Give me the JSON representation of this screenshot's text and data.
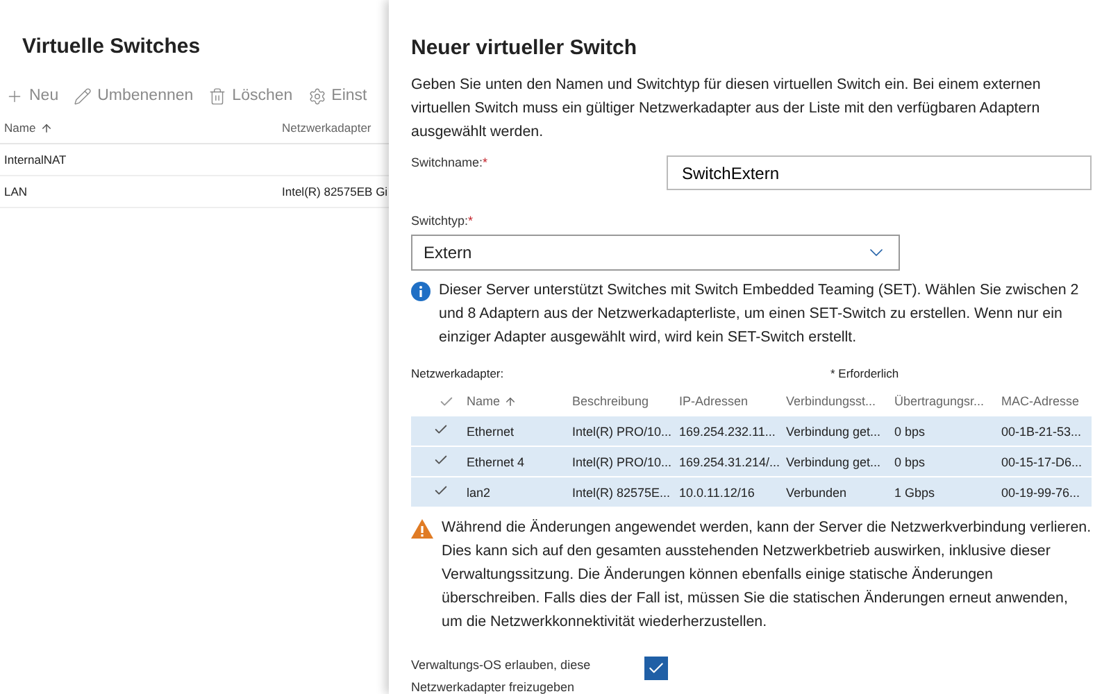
{
  "list_panel": {
    "title": "Virtuelle Switches",
    "toolbar": [
      {
        "label": "Neu"
      },
      {
        "label": "Umbenennen"
      },
      {
        "label": "Löschen"
      },
      {
        "label": "Einst"
      }
    ],
    "columns": [
      {
        "label": "Name",
        "sorted": true
      },
      {
        "label": "Netzwerkadapter",
        "sorted": false
      }
    ],
    "rows": [
      [
        "InternalNAT",
        ""
      ],
      [
        "LAN",
        "Intel(R) 82575EB Gi"
      ]
    ]
  },
  "dialog": {
    "title": "Neuer virtueller Switch",
    "intro": "Geben Sie unten den Namen und Switchtyp für diesen virtuellen Switch ein. Bei einem externen virtuellen Switch muss ein gültiger Netzwerkadapter aus der Liste mit den verfügbaren Adaptern ausgewählt werden.",
    "name_field": {
      "label": "Switchname:",
      "required_mark": "*",
      "value": "SwitchExtern"
    },
    "type_field": {
      "label": "Switchtyp:",
      "required_mark": "*",
      "value": "Extern"
    },
    "info": "Dieser Server unterstützt Switches mit Switch Embedded Teaming (SET). Wählen Sie zwischen 2 und 8 Adaptern aus der Netzwerkadapterliste, um einen SET-Switch zu erstellen. Wenn nur ein einziger Adapter ausgewählt wird, wird kein SET-Switch erstellt.",
    "adapters": {
      "label": "Netzwerkadapter:",
      "required_note": "* Erforderlich",
      "columns": [
        {
          "label": "Name",
          "sorted": true
        },
        {
          "label": "Beschreibung",
          "sorted": false
        },
        {
          "label": "IP-Adressen",
          "sorted": false
        },
        {
          "label": "Verbindungsst...",
          "sorted": false
        },
        {
          "label": "Übertragungsr...",
          "sorted": false
        },
        {
          "label": "MAC-Adresse",
          "sorted": false
        }
      ],
      "rows": [
        {
          "selected": true,
          "cells": [
            "Ethernet",
            "Intel(R) PRO/10...",
            "169.254.232.11...",
            "Verbindung get...",
            "0 bps",
            "00-1B-21-53..."
          ]
        },
        {
          "selected": true,
          "cells": [
            "Ethernet 4",
            "Intel(R) PRO/10...",
            "169.254.31.214/...",
            "Verbindung get...",
            "0 bps",
            "00-15-17-D6..."
          ]
        },
        {
          "selected": true,
          "cells": [
            "lan2",
            "Intel(R) 82575E...",
            "10.0.11.12/16",
            "Verbunden",
            "1 Gbps",
            "00-19-99-76..."
          ]
        }
      ]
    },
    "warning": "Während die Änderungen angewendet werden, kann der Server die Netzwerkverbindung verlieren. Dies kann sich auf den gesamten ausstehenden Netzwerkbetrieb auswirken, inklusive dieser Verwaltungssitzung. Die Änderungen können ebenfalls einige statische Änderungen überschreiben. Falls dies der Fall ist, müssen Sie die statischen Änderungen erneut anwenden, um die Netzwerkkonnektivität wiederherzustellen.",
    "share_option": {
      "label": "Verwaltungs-OS erlauben, diese Netzwerkadapter freizugeben",
      "checked": true
    }
  }
}
